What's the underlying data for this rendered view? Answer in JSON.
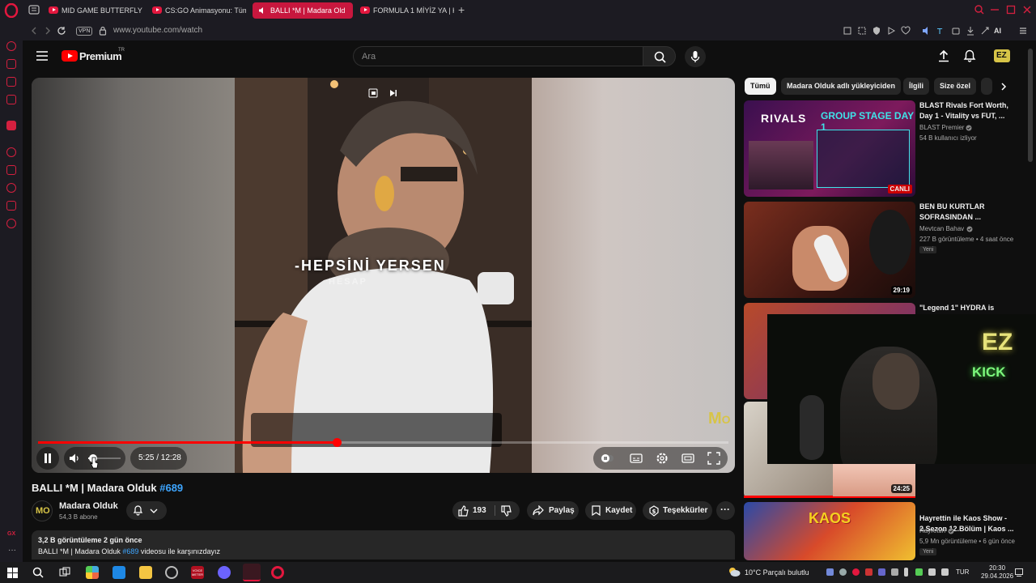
{
  "browser": {
    "tabs": [
      {
        "label": "MID GAME BUTTERFLY EK",
        "active": false
      },
      {
        "label": "CS:GO Animasyonu: Tüm ",
        "active": false
      },
      {
        "label": "BALLI *M | Madara Old",
        "active": true
      },
      {
        "label": "FORMULA 1 MİYİZ YA | Kar",
        "active": false
      }
    ],
    "new_tab": "+",
    "url": "www.youtube.com/watch",
    "vpn_label": "VPN",
    "toolbar_ai_label": "AI",
    "accent_color": "#c8173e"
  },
  "youtube": {
    "logo_text": "Premium",
    "logo_region": "TR",
    "search_placeholder": "Ara",
    "player": {
      "caption_main": "-HEPSİNİ YERSEN",
      "caption_sub": "HESAP",
      "watermark": "M",
      "time": "5:25 / 12:28",
      "progress": 0.433,
      "volume": 0.15
    },
    "video": {
      "title": "BALLI *M | Madara Olduk",
      "title_tag": "#689",
      "channel": "Madara Olduk",
      "subscribers": "54,3 B abone",
      "likes": "193",
      "share_label": "Paylaş",
      "save_label": "Kaydet",
      "thanks_label": "Teşekkürler",
      "views_age": "3,2 B görüntüleme  2 gün önce",
      "desc_prefix": "BALLI *M | Madara Olduk ",
      "desc_tag": "#689",
      "desc_suffix": " videosu ile karşınızdayız"
    },
    "chips": [
      "Tümü",
      "Madara Olduk adlı yükleyiciden",
      "İlgili",
      "Size özel"
    ],
    "recommendations": [
      {
        "title": "BLAST Rivals Fort Worth, Day 1 - Vitality vs FUT, ...",
        "channel": "BLAST Premier",
        "meta": "54 B kullanıcı izliyor",
        "badge": "",
        "duration": "",
        "live_label": "CANLI",
        "thumb_text": "GROUP STAGE DAY 1",
        "thumb_logo": "RIVALS"
      },
      {
        "title": "BEN BU KURTLAR SOFRASINDAN ...",
        "channel": "Mevtcan Bahav",
        "meta": "227 B görüntüleme • 4 saat önce",
        "badge": "Yeni",
        "duration": "29:19"
      },
      {
        "title": "\"Legend 1\" HYDRA is",
        "channel": "",
        "meta": "",
        "badge": "",
        "duration": ""
      },
      {
        "title": "",
        "channel": "",
        "meta": "",
        "badge": "",
        "duration": "24:25"
      },
      {
        "title": "Hayrettin ile Kaos Show - 2.Sezon 12.Bölüm | Kaos ...",
        "channel": "Hayrettin",
        "meta": "5,9 Mn görüntüleme • 6 gün önce",
        "badge": "Yeni",
        "duration": "",
        "thumb_text": "KAOS"
      }
    ],
    "webcam_overlay": {
      "line1": "EZ",
      "line2": "KICK"
    }
  },
  "taskbar": {
    "weather_temp": "10°C",
    "weather_text": "Parçalı bulutlu",
    "lang": "TUR",
    "time": "20:30",
    "date": "29.04.2026",
    "app_badge": "VOICE METER"
  }
}
